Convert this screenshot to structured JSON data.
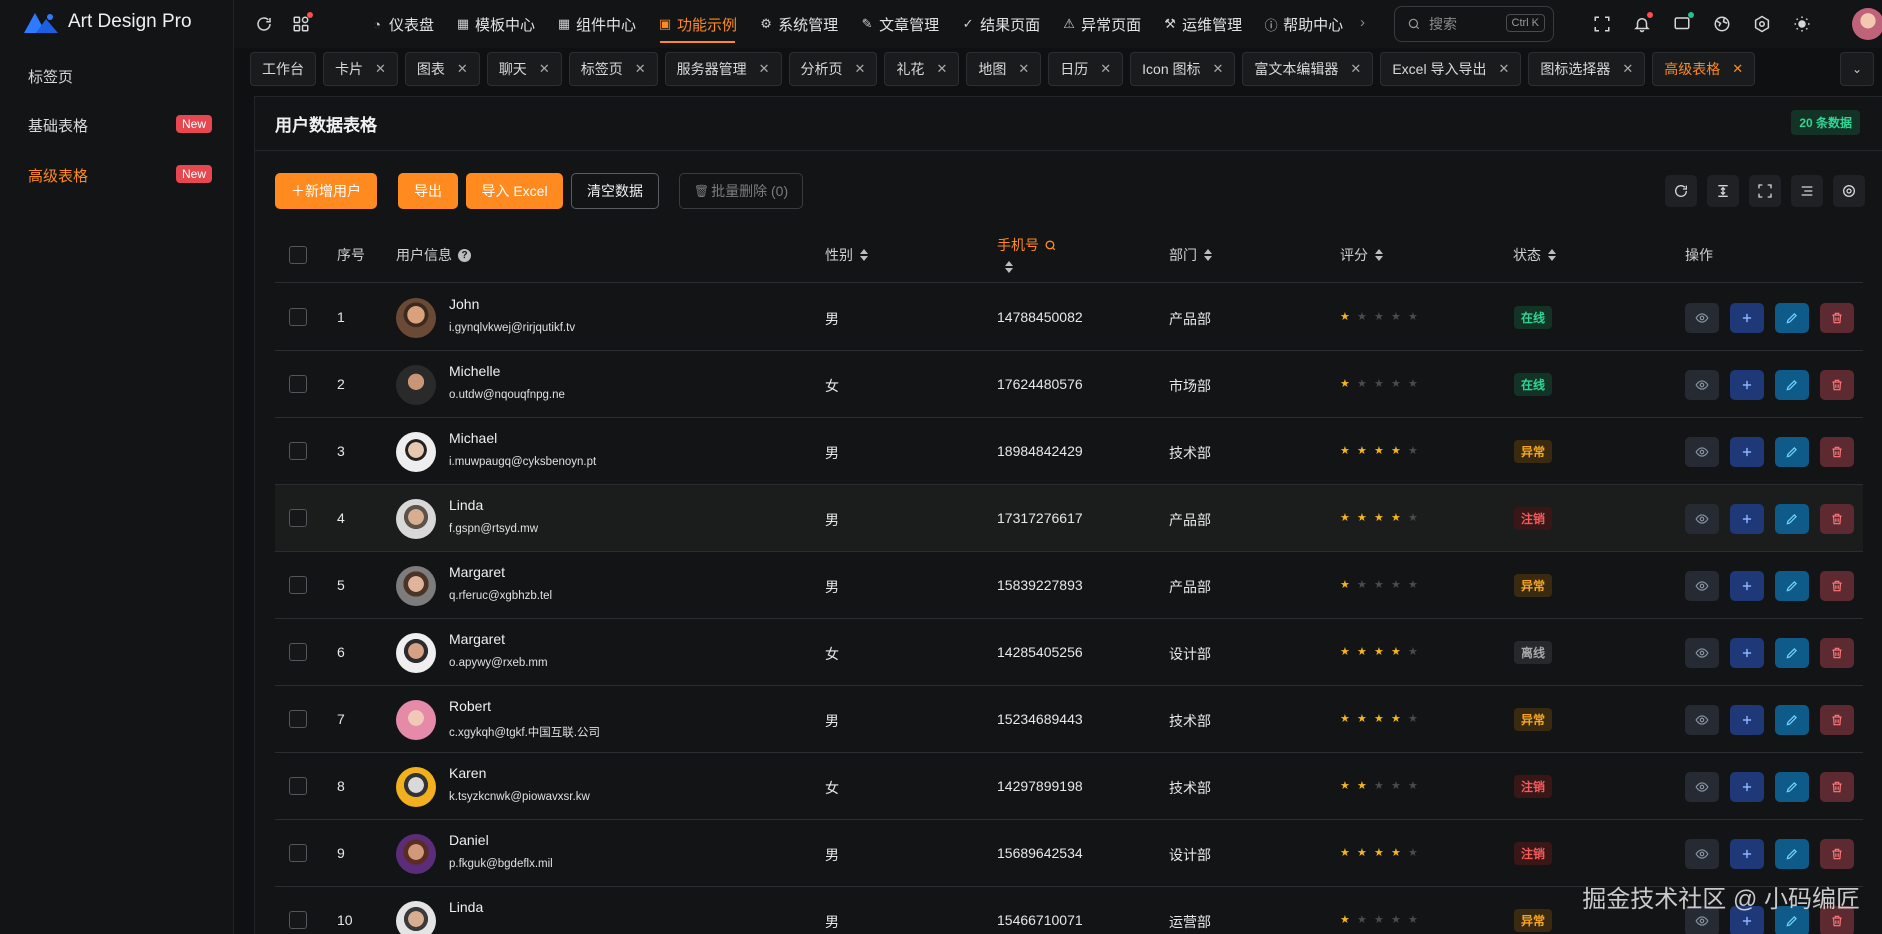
{
  "app": {
    "name": "Art Design Pro"
  },
  "sidebar": {
    "items": [
      {
        "label": "标签页",
        "badge": ""
      },
      {
        "label": "基础表格",
        "badge": "New"
      },
      {
        "label": "高级表格",
        "badge": "New",
        "active": true
      }
    ]
  },
  "topbar": {
    "menu": [
      {
        "label": "仪表盘",
        "icon": "dashboard-icon"
      },
      {
        "label": "模板中心",
        "icon": "grid-icon"
      },
      {
        "label": "组件中心",
        "icon": "grid-icon"
      },
      {
        "label": "功能示例",
        "icon": "feature-icon",
        "active": true
      },
      {
        "label": "系统管理",
        "icon": "gear-icon"
      },
      {
        "label": "文章管理",
        "icon": "article-icon"
      },
      {
        "label": "结果页面",
        "icon": "check-circle-icon"
      },
      {
        "label": "异常页面",
        "icon": "warning-icon"
      },
      {
        "label": "运维管理",
        "icon": "wrench-icon"
      },
      {
        "label": "帮助中心",
        "icon": "info-icon"
      }
    ],
    "search": {
      "placeholder": "搜索",
      "shortcut": "Ctrl K"
    }
  },
  "tabs": [
    {
      "label": "工作台",
      "closable": false
    },
    {
      "label": "卡片",
      "closable": true
    },
    {
      "label": "图表",
      "closable": true
    },
    {
      "label": "聊天",
      "closable": true
    },
    {
      "label": "标签页",
      "closable": true
    },
    {
      "label": "服务器管理",
      "closable": true
    },
    {
      "label": "分析页",
      "closable": true
    },
    {
      "label": "礼花",
      "closable": true
    },
    {
      "label": "地图",
      "closable": true
    },
    {
      "label": "日历",
      "closable": true
    },
    {
      "label": "Icon 图标",
      "closable": true
    },
    {
      "label": "富文本编辑器",
      "closable": true
    },
    {
      "label": "Excel 导入导出",
      "closable": true
    },
    {
      "label": "图标选择器",
      "closable": true
    },
    {
      "label": "高级表格",
      "closable": true,
      "active": true
    }
  ],
  "panel": {
    "title": "用户数据表格",
    "count_badge": "20 条数据",
    "buttons": {
      "add_user": "＋新增用户",
      "export": "导出",
      "import_excel": "导入 Excel",
      "clear": "清空数据",
      "batch_delete": "批量删除 (0)"
    }
  },
  "table": {
    "headers": {
      "index": "序号",
      "user_info": "用户信息",
      "gender": "性别",
      "phone": "手机号",
      "dept": "部门",
      "score": "评分",
      "status": "状态",
      "actions": "操作"
    },
    "rows": [
      {
        "index": "1",
        "name": "John",
        "email": "i.gynqlvkwej@rirjqutikf.tv",
        "gender": "男",
        "phone": "14788450082",
        "dept": "产品部",
        "rating": 1,
        "status": "在线",
        "status_type": "online"
      },
      {
        "index": "2",
        "name": "Michelle",
        "email": "o.utdw@nqouqfnpg.ne",
        "gender": "女",
        "phone": "17624480576",
        "dept": "市场部",
        "rating": 1,
        "status": "在线",
        "status_type": "online"
      },
      {
        "index": "3",
        "name": "Michael",
        "email": "i.muwpaugq@cyksbenoyn.pt",
        "gender": "男",
        "phone": "18984842429",
        "dept": "技术部",
        "rating": 4,
        "status": "异常",
        "status_type": "warn"
      },
      {
        "index": "4",
        "name": "Linda",
        "email": "f.gspn@rtsyd.mw",
        "gender": "男",
        "phone": "17317276617",
        "dept": "产品部",
        "rating": 4,
        "status": "注销",
        "status_type": "cancel",
        "highlight": true
      },
      {
        "index": "5",
        "name": "Margaret",
        "email": "q.rferuc@xgbhzb.tel",
        "gender": "男",
        "phone": "15839227893",
        "dept": "产品部",
        "rating": 1,
        "status": "异常",
        "status_type": "warn"
      },
      {
        "index": "6",
        "name": "Margaret",
        "email": "o.apywy@rxeb.mm",
        "gender": "女",
        "phone": "14285405256",
        "dept": "设计部",
        "rating": 4,
        "status": "离线",
        "status_type": "offline"
      },
      {
        "index": "7",
        "name": "Robert",
        "email": "c.xgykqh@tgkf.中国互联.公司",
        "gender": "男",
        "phone": "15234689443",
        "dept": "技术部",
        "rating": 4,
        "status": "异常",
        "status_type": "warn"
      },
      {
        "index": "8",
        "name": "Karen",
        "email": "k.tsyzkcnwk@piowavxsr.kw",
        "gender": "女",
        "phone": "14297899198",
        "dept": "技术部",
        "rating": 2,
        "status": "注销",
        "status_type": "cancel"
      },
      {
        "index": "9",
        "name": "Daniel",
        "email": "p.fkguk@bgdeflx.mil",
        "gender": "男",
        "phone": "15689642534",
        "dept": "设计部",
        "rating": 4,
        "status": "注销",
        "status_type": "cancel"
      },
      {
        "index": "10",
        "name": "Linda",
        "email": "",
        "gender": "男",
        "phone": "15466710071",
        "dept": "运营部",
        "rating": 1,
        "status": "异常",
        "status_type": "warn"
      }
    ]
  },
  "watermark": "掘金技术社区 @ 小码编匠",
  "colors": {
    "accent": "#ff8a1f",
    "online": "#2fd594",
    "warn": "#f6a623",
    "cancel": "#f35a5a",
    "star": "#f6b51e"
  }
}
